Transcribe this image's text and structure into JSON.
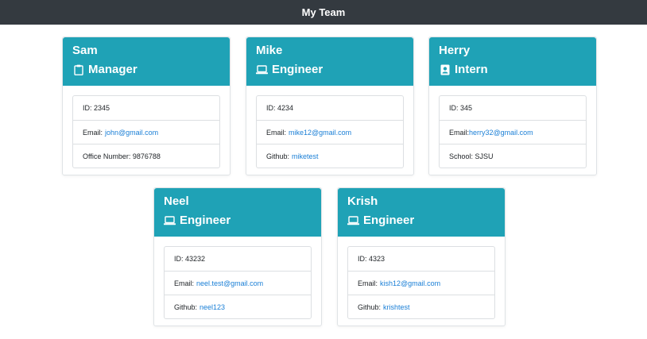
{
  "navbar": {
    "title": "My Team"
  },
  "colors": {
    "navbar_bg": "#343a40",
    "card_header_bg": "#1fa2b6",
    "link": "#1a7fd6"
  },
  "cards": [
    {
      "name": "Sam",
      "role": "Manager",
      "icon": "clipboard-icon",
      "id_text": "ID: 2345",
      "email_label": "Email:",
      "email": "john@gmail.com",
      "extra_label": "Office Number: 9876788",
      "extra_link": ""
    },
    {
      "name": "Mike",
      "role": "Engineer",
      "icon": "laptop-icon",
      "id_text": "ID: 4234",
      "email_label": "Email:",
      "email": "mike12@gmail.com",
      "extra_label": "Github:",
      "extra_link": "miketest"
    },
    {
      "name": "Herry",
      "role": "Intern",
      "icon": "id-badge-icon",
      "id_text": "ID: 345",
      "email_label": "Email:",
      "email": "herry32@gmail.com",
      "extra_label": "School: SJSU",
      "extra_link": ""
    },
    {
      "name": "Neel",
      "role": "Engineer",
      "icon": "laptop-icon",
      "id_text": "ID: 43232",
      "email_label": "Email:",
      "email": "neel.test@gmail.com",
      "extra_label": "Github:",
      "extra_link": "neel123"
    },
    {
      "name": "Krish",
      "role": "Engineer",
      "icon": "laptop-icon",
      "id_text": "ID: 4323",
      "email_label": "Email:",
      "email": "kish12@gmail.com",
      "extra_label": "Github:",
      "extra_link": "krishtest"
    }
  ]
}
